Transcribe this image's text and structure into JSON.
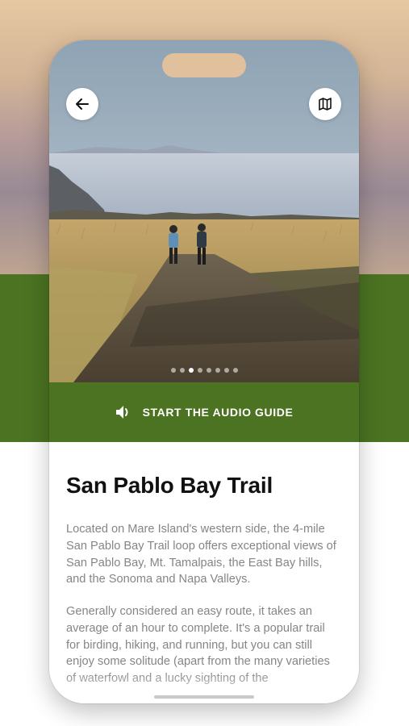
{
  "hero": {
    "image_description_icon": "trail-photo",
    "pagination": {
      "count": 8,
      "active_index": 2
    }
  },
  "nav": {
    "back_icon": "arrow-left-icon",
    "map_icon": "map-icon"
  },
  "audio_guide": {
    "icon": "speaker-icon",
    "label": "START THE AUDIO GUIDE"
  },
  "trail": {
    "title": "San Pablo Bay Trail",
    "paragraph1": "Located on Mare Island's western side, the 4-mile San Pablo Bay Trail loop offers exceptional views of San Pablo Bay, Mt. Tamalpais, the East Bay hills, and the Sonoma and Napa Valleys.",
    "paragraph2": "Generally considered an easy route, it takes an average of an hour to complete. It's a popular trail for birding, hiking, and running, but you can still enjoy some solitude (apart from the many varieties of waterfowl and a lucky sighting of the"
  },
  "colors": {
    "accent_green": "#4b7322",
    "title": "#111111",
    "body": "#858585"
  }
}
